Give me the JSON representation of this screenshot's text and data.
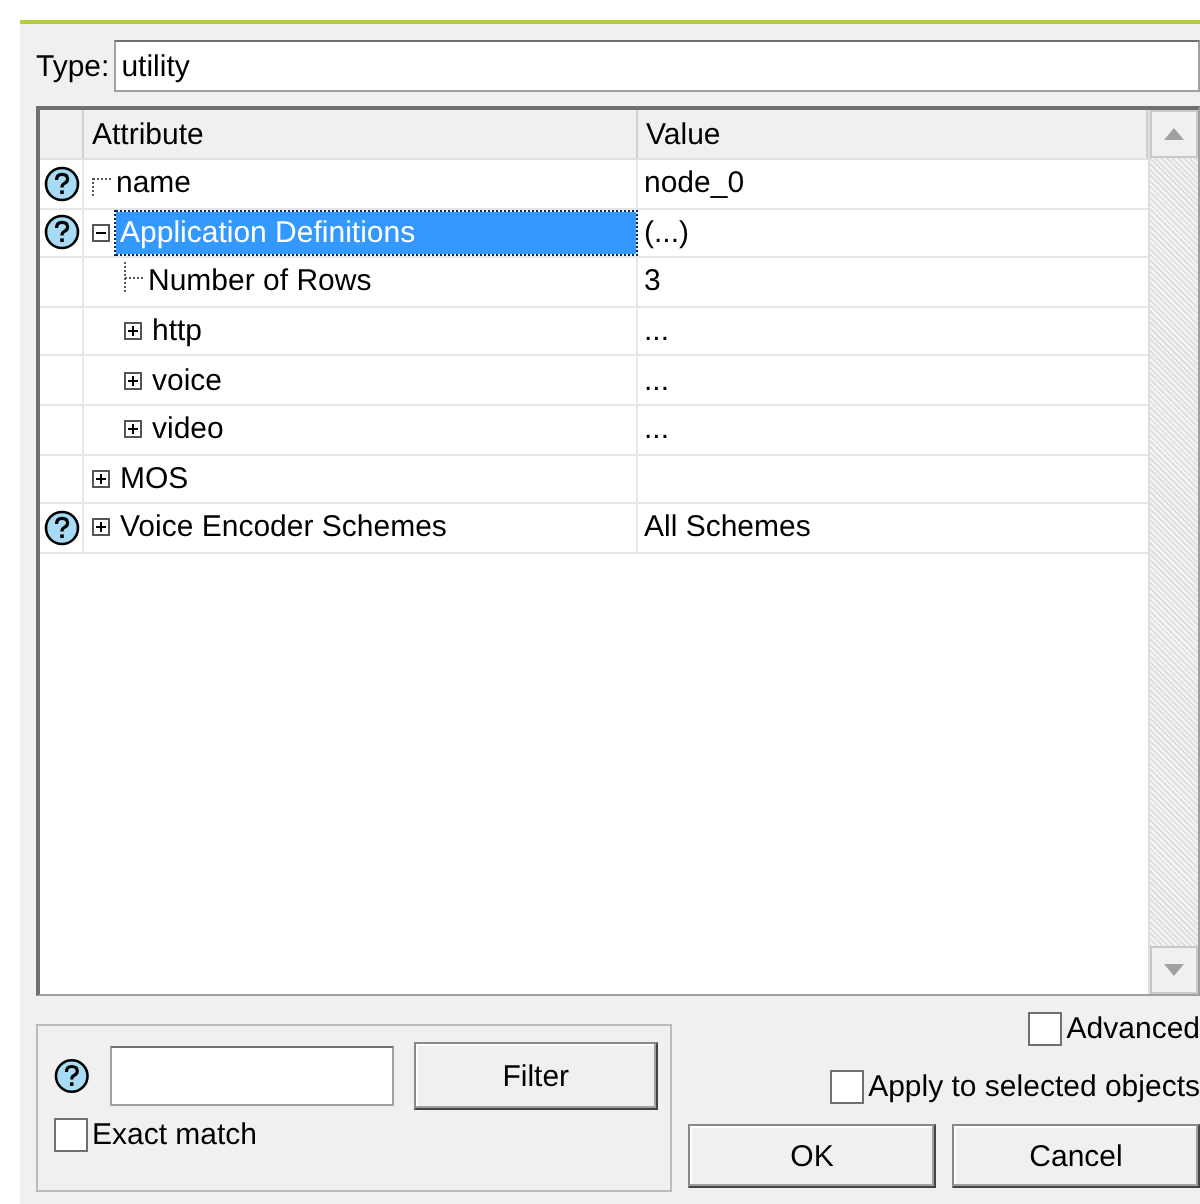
{
  "type_field": {
    "label": "Type:",
    "value": "utility"
  },
  "table": {
    "columns": [
      "Attribute",
      "Value"
    ],
    "rows": [
      {
        "attribute": "name",
        "value": "node_0",
        "help": true,
        "selected": false
      },
      {
        "attribute": "Application Definitions",
        "value": "(...)",
        "help": true,
        "selected": true,
        "expanded": true,
        "children": [
          {
            "attribute": "Number of Rows",
            "value": "3",
            "help": false,
            "selected": false
          },
          {
            "attribute": "http",
            "value": "...",
            "help": false,
            "selected": false,
            "expanded": false
          },
          {
            "attribute": "voice",
            "value": "...",
            "help": false,
            "selected": false,
            "expanded": false
          },
          {
            "attribute": "video",
            "value": "...",
            "help": false,
            "selected": false,
            "expanded": false
          }
        ]
      },
      {
        "attribute": "MOS",
        "help": false,
        "selected": false,
        "expanded": false
      },
      {
        "attribute": "Voice Encoder Schemes",
        "value": "All Schemes",
        "help": true,
        "selected": false,
        "expanded": false
      }
    ]
  },
  "filter": {
    "help": true,
    "button": {
      "label": "Filter"
    },
    "exact_match": {
      "label": "Exact match",
      "checked": false
    }
  },
  "advanced": {
    "label": "Advanced",
    "checked": false
  },
  "apply_selected": {
    "label": "Apply to selected objects",
    "checked": false
  },
  "buttons": [
    {
      "label": "OK"
    },
    {
      "label": "Cancel"
    }
  ]
}
